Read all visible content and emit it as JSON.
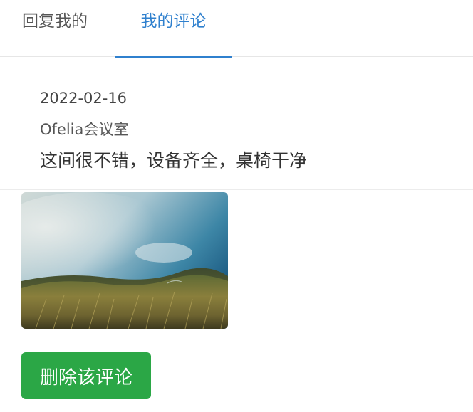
{
  "tabs": [
    {
      "label": "回复我的",
      "active": false
    },
    {
      "label": "我的评论",
      "active": true
    }
  ],
  "comment": {
    "date": "2022-02-16",
    "room": "Ofelia会议室",
    "text": "这间很不错，设备齐全，桌椅干净",
    "photo": "landscape-grassland-sky-photo"
  },
  "actions": {
    "delete_label": "删除该评论"
  },
  "colors": {
    "accent": "#2f80ce",
    "delete_button": "#2ba746",
    "text": "#333333",
    "divider": "#e6e6e6"
  }
}
